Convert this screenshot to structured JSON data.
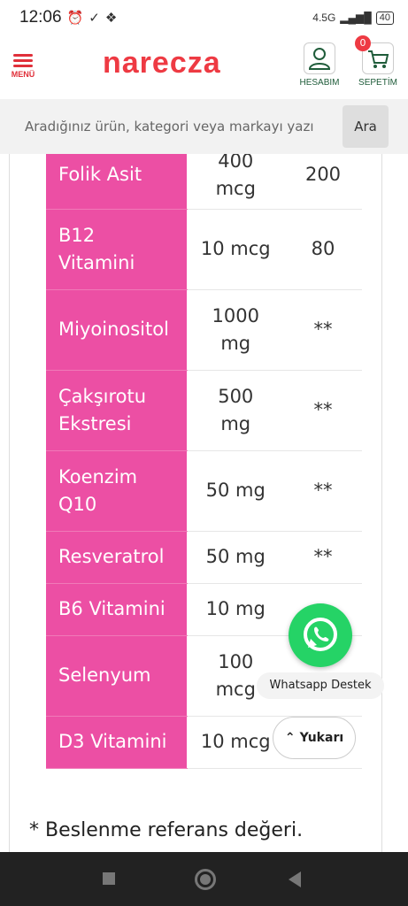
{
  "status": {
    "time": "12:06",
    "network": "4.5G",
    "battery": "40"
  },
  "header": {
    "menu_label": "MENÜ",
    "logo": "narecza",
    "account_label": "HESABIM",
    "cart_label": "SEPETİM",
    "cart_count": "0",
    "brand_color": "#ee3a43"
  },
  "search": {
    "placeholder": "Aradığınız ürün, kategori veya markayı yazı",
    "button_label": "Ara"
  },
  "table": {
    "header_color": "#ec4fa4",
    "rows": [
      {
        "name": "Folik Asit",
        "amount": "400\nmcg",
        "ref": "200"
      },
      {
        "name": "B12\nVitamini",
        "amount": "10 mcg",
        "ref": "80"
      },
      {
        "name": "Miyoinositol",
        "amount": "1000\nmg",
        "ref": "**"
      },
      {
        "name": "Çakşırotu\nEkstresi",
        "amount": "500\nmg",
        "ref": "**"
      },
      {
        "name": "Koenzim\nQ10",
        "amount": "50 mg",
        "ref": "**"
      },
      {
        "name": "Resveratrol",
        "amount": "50 mg",
        "ref": "**"
      },
      {
        "name": "B6 Vitamini",
        "amount": "10 mg",
        "ref": ""
      },
      {
        "name": "Selenyum",
        "amount": "100\nmcg",
        "ref": ""
      },
      {
        "name": "D3 Vitamini",
        "amount": "10 mcg",
        "ref": ""
      }
    ]
  },
  "footnote": "* Beslenme referans değeri.",
  "whatsapp": {
    "label": "Whatsapp Destek",
    "color": "#25d366"
  },
  "scroll_up": {
    "label": "Yukarı"
  }
}
